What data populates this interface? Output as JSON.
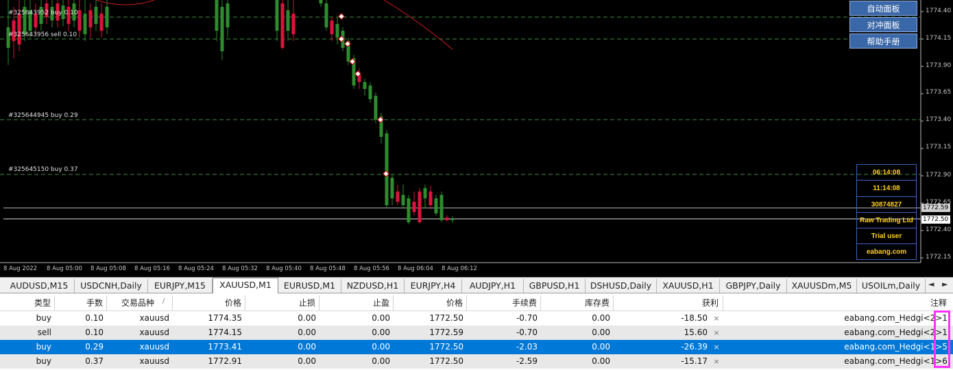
{
  "chart": {
    "order_lines": [
      {
        "label": "#325643952 buy 0.10",
        "color": "#3a9a3a"
      },
      {
        "label": "#325643956 sell 0.10",
        "color": "#3a9a3a"
      },
      {
        "label": "#325644945 buy 0.29",
        "color": "#3a9a3a"
      },
      {
        "label": "#325645150 buy 0.37",
        "color": "#3a9a3a"
      }
    ],
    "price_ticks": [
      "1774.40",
      "1774.15",
      "1773.90",
      "1773.65",
      "1773.40",
      "1773.15",
      "1772.90",
      "1772.65",
      "1772.40",
      "1772.15"
    ],
    "current_prices": {
      "ask": "1772.59",
      "bid": "1772.50"
    },
    "time_ticks": [
      "8 Aug 2022",
      "8 Aug 05:00",
      "8 Aug 05:08",
      "8 Aug 05:16",
      "8 Aug 05:24",
      "8 Aug 05:32",
      "8 Aug 05:40",
      "8 Aug 05:48",
      "8 Aug 05:56",
      "8 Aug 06:04",
      "8 Aug 06:12"
    ],
    "colors": {
      "bull": "#2e8b2e",
      "bear": "#dc143c",
      "ma": "#d21e1e",
      "grid_dash": "#3f8f3f"
    }
  },
  "ea_buttons": [
    "自动面板",
    "对冲面板",
    "帮助手册"
  ],
  "info_panel": [
    "06:14:08",
    "11:14:08",
    "30874827",
    "Raw Trading Ltd",
    "Trial user",
    "eabang.com"
  ],
  "tabs": [
    {
      "label": "AUDUSD,M15"
    },
    {
      "label": "USDCNH,Daily"
    },
    {
      "label": "EURJPY,M15"
    },
    {
      "label": "XAUUSD,M1"
    },
    {
      "label": "EURUSD,M1"
    },
    {
      "label": "NZDUSD,H1"
    },
    {
      "label": "EURJPY,H4"
    },
    {
      "label": "AUDJPY,H1"
    },
    {
      "label": "GBPUSD,H1"
    },
    {
      "label": "DSHUSD,Daily"
    },
    {
      "label": "XAUUSD,H1"
    },
    {
      "label": "GBPJPY,Daily"
    },
    {
      "label": "XAUUSDm,M5"
    },
    {
      "label": "USOILm,Daily"
    }
  ],
  "active_tab": 3,
  "tab_scroll": {
    "left": "◄",
    "right": "►"
  },
  "table": {
    "columns": [
      "类型",
      "手数",
      "交易品种",
      "价格",
      "止损",
      "止盈",
      "价格",
      "手续费",
      "库存费",
      "获利",
      "注释"
    ],
    "sort_indicator": "/",
    "rows": [
      {
        "type": "buy",
        "lots": "0.10",
        "symbol": "xauusd",
        "open_price": "1774.35",
        "sl": "0.00",
        "tp": "0.00",
        "price": "1772.50",
        "commission": "-0.70",
        "swap": "0.00",
        "profit": "-18.50",
        "comment": "eabang.com_Hedgi<2>1;"
      },
      {
        "type": "sell",
        "lots": "0.10",
        "symbol": "xauusd",
        "open_price": "1774.15",
        "sl": "0.00",
        "tp": "0.00",
        "price": "1772.59",
        "commission": "-0.70",
        "swap": "0.00",
        "profit": "15.60",
        "comment": "eabang.com_Hedgi<2>1;"
      },
      {
        "type": "buy",
        "lots": "0.29",
        "symbol": "xauusd",
        "open_price": "1773.41",
        "sl": "0.00",
        "tp": "0.00",
        "price": "1772.50",
        "commission": "-2.03",
        "swap": "0.00",
        "profit": "-26.39",
        "comment": "eabang.com_Hedgi<1>5;"
      },
      {
        "type": "buy",
        "lots": "0.37",
        "symbol": "xauusd",
        "open_price": "1772.91",
        "sl": "0.00",
        "tp": "0.00",
        "price": "1772.50",
        "commission": "-2.59",
        "swap": "0.00",
        "profit": "-15.17",
        "comment": "eabang.com_Hedgi<1>6;"
      }
    ],
    "selected_row": 2,
    "close_icon": "×"
  }
}
